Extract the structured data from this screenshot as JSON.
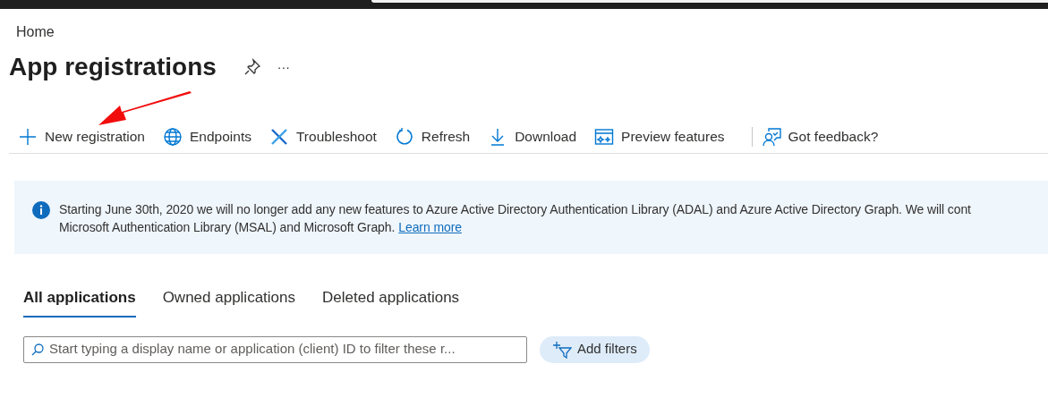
{
  "breadcrumb": "Home",
  "title": "App registrations",
  "more": "···",
  "toolbar": [
    {
      "kind": "plus",
      "label": "New registration"
    },
    {
      "kind": "globe",
      "label": "Endpoints"
    },
    {
      "kind": "wrench",
      "label": "Troubleshoot"
    },
    {
      "kind": "refresh",
      "label": "Refresh"
    },
    {
      "kind": "download",
      "label": "Download"
    },
    {
      "kind": "preview",
      "label": "Preview features"
    },
    {
      "kind": "separator"
    },
    {
      "kind": "feedback",
      "label": "Got feedback?"
    }
  ],
  "banner": {
    "line_1": "Starting June 30th, 2020 we will no longer add any new features to Azure Active Directory Authentication Library (ADAL) and Azure Active Directory Graph. We will cont",
    "line_2": "Microsoft Authentication Library (MSAL) and Microsoft Graph.",
    "link": "Learn more"
  },
  "tabs": [
    {
      "label": "All applications",
      "selected": true
    },
    {
      "label": "Owned applications",
      "selected": false
    },
    {
      "label": "Deleted applications",
      "selected": false
    }
  ],
  "search": {
    "placeholder": "Start typing a display name or application (client) ID to filter these r..."
  },
  "filter_button": "Add filters"
}
